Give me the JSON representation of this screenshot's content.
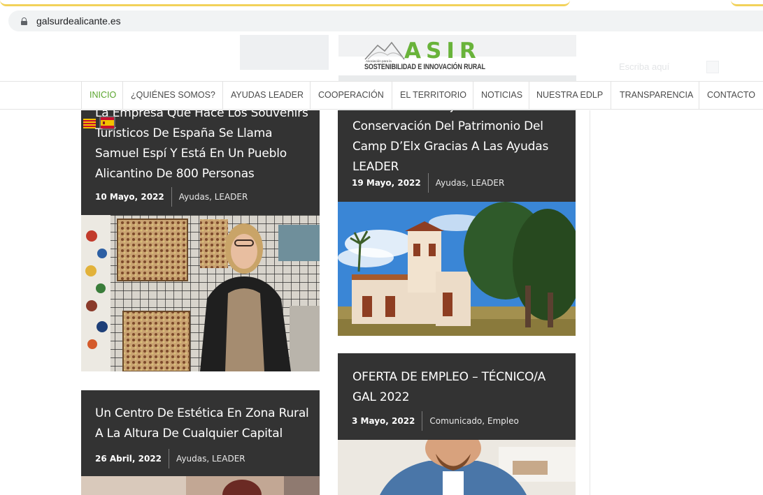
{
  "browser": {
    "url": "galsurdealicante.es"
  },
  "header": {
    "logo_word": "ASIR",
    "logo_small": "Asociación para la",
    "logo_sub": "SOSTENIBILIDAD E INNOVACIÓN RURAL",
    "ghost_search": "Escriba aquí"
  },
  "nav": {
    "items": [
      {
        "label": "INICIO",
        "active": true
      },
      {
        "label": "¿QUIÉNES SOMOS?"
      },
      {
        "label": "AYUDAS LEADER"
      },
      {
        "label": "COOPERACIÓN"
      },
      {
        "label": "EL TERRITORIO"
      },
      {
        "label": "NOTICIAS"
      },
      {
        "label": "NUESTRA EDLP"
      },
      {
        "label": "TRANSPARENCIA"
      },
      {
        "label": "CONTACTO"
      }
    ]
  },
  "posts": [
    {
      "title_lines": [
        "La Empresa Que Hace Los Souvenirs",
        "Turísticos De España Se Llama",
        "Samuel Espí Y Está En Un Pueblo",
        "Alicantino De 800 Personas"
      ],
      "date": "10 Mayo, 2022",
      "categories": "Ayudas,  LEADER",
      "image": "woman-with-pins-photo"
    },
    {
      "title_lines": [
        "Actuación De Mejora Y Puesta En Valor",
        "Conservación Del Patrimonio Del",
        "Camp D’Elx Gracias A Las Ayudas",
        "LEADER"
      ],
      "date": "19 Mayo, 2022",
      "categories": "Ayudas,  LEADER",
      "image": "historic-house-photo"
    },
    {
      "title_lines": [
        "Un Centro De Estética En Zona Rural",
        "A La Altura De Cualquier Capital"
      ],
      "date": "26 Abril, 2022",
      "categories": "Ayudas,  LEADER"
    },
    {
      "title_lines": [
        "OFERTA DE EMPLEO – TÉCNICO/A",
        "GAL 2022"
      ],
      "date": "3 Mayo, 2022",
      "categories": "Comunicado,  Empleo"
    }
  ],
  "colors": {
    "accent_green": "#69b33a",
    "card_bg": "#333333"
  }
}
